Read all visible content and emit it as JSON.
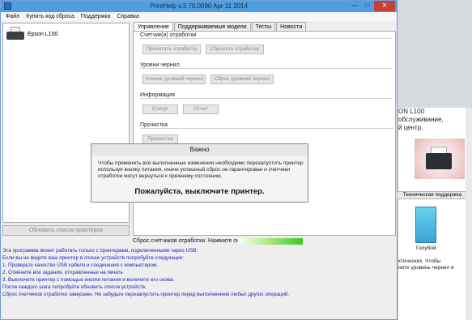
{
  "window": {
    "title": "PrintHelp v.3.70.0090 Apr 11 2014",
    "minimize": "—",
    "maximize": "□",
    "close": "✕"
  },
  "menu": [
    "Файл",
    "Купить код сброса",
    "Поддержка",
    "Справка"
  ],
  "devices": [
    {
      "name": "Epson L100"
    }
  ],
  "refresh_button": "Обновить список принтеров",
  "tabs": [
    "Управление",
    "Поддерживаемые модели",
    "Тесты",
    "Новости"
  ],
  "groups": {
    "counters": {
      "title": "Счетчик(и) отработки",
      "read": "Прочитать отработку",
      "reset": "Сбросить отработку"
    },
    "ink": {
      "title": "Уровни чернил",
      "read": "Чтение уровней чернил",
      "reset": "Сброс уровней чернил"
    },
    "info": {
      "title": "Информация",
      "status": "Статус",
      "report": "Отчет"
    },
    "cleaning": {
      "title": "Прочистка",
      "btn": "Прочистка"
    }
  },
  "status_line": "Сброс счетчиков отработки. Нажмите сюда для отмены.",
  "log_lines": [
    "Эта программа может работать только с принтерами, подключенными через USB.",
    "Если вы не видите ваш принтер в списке устройств попробуйте следующее:",
    "1. Проверьте качество USB кабеля и соединения с компьютером.",
    "2. Отмените все задания, отправленные на печать",
    "3. Выключите принтер с помощью кнопки питания и включите его снова.",
    "После каждого шага попробуйте обновить список устройств.",
    "Сброс счетчиков отработки завершен. Не забудьте перезапустить принтер перед выполнением любых других операций."
  ],
  "modal": {
    "title": "Важно",
    "message": "Чтобы применить все выполненные изменения необходимо перезапустить принтер используя кнопку питания, иначе успешный сброс не гарантирован и счетчики отработки могут вернуться к прежнему состоянию.",
    "emphasis": "Пожалуйста, выключите принтер."
  },
  "side_panel": {
    "header_lines": [
      "ON L100",
      "обслуживание,",
      "й центр."
    ],
    "support_button": "Техническая поддержка",
    "ink_label": "Голубой",
    "note_lines": [
      "ктических. Чтобы",
      "ните уровень чернил в"
    ]
  }
}
